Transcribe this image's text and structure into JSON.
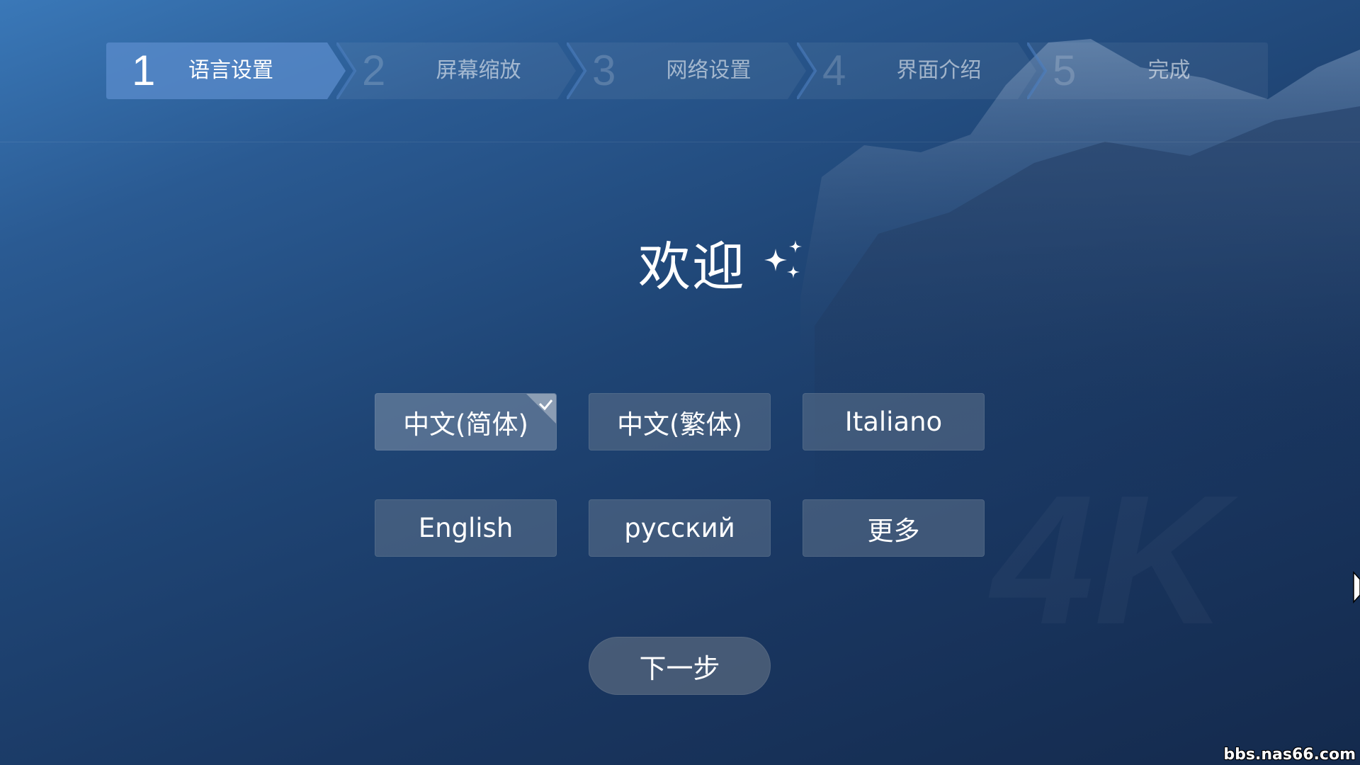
{
  "steps": [
    {
      "number": "1",
      "label": "语言设置",
      "active": true
    },
    {
      "number": "2",
      "label": "屏幕缩放",
      "active": false
    },
    {
      "number": "3",
      "label": "网络设置",
      "active": false
    },
    {
      "number": "4",
      "label": "界面介绍",
      "active": false
    },
    {
      "number": "5",
      "label": "完成",
      "active": false
    }
  ],
  "welcome": {
    "title": "欢迎",
    "icon": "sparkle-icon"
  },
  "languages": [
    {
      "label": "中文(简体)",
      "selected": true
    },
    {
      "label": "中文(繁体)",
      "selected": false
    },
    {
      "label": "Italiano",
      "selected": false
    },
    {
      "label": "English",
      "selected": false
    },
    {
      "label": "русский",
      "selected": false
    },
    {
      "label": "更多",
      "selected": false
    }
  ],
  "next_button": {
    "label": "下一步"
  },
  "watermark": "bbs.nas66.com",
  "colors": {
    "background_top": "#3a78b8",
    "background_bottom": "#142a4d",
    "step_active": "#5b8ccc",
    "button_bg": "#5f738c"
  }
}
